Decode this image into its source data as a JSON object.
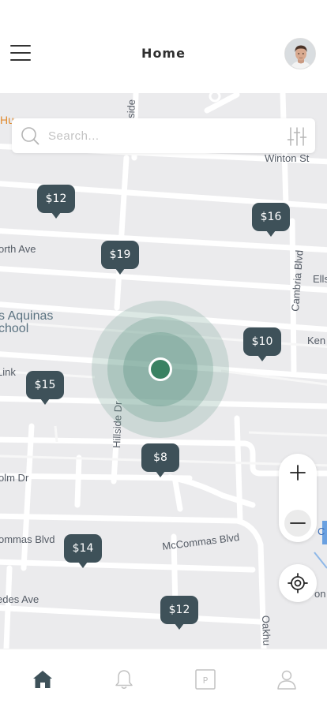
{
  "header": {
    "title": "Home",
    "menu_icon": "hamburger-menu-icon",
    "avatar": "user-avatar"
  },
  "search": {
    "placeholder": "Search...",
    "icon": "search-icon",
    "filter_icon": "filter-sliders-icon"
  },
  "map": {
    "street_labels": [
      "Winton St",
      "orth Ave",
      "Cambria Blvd",
      "Ells",
      "s Aquinas",
      "chool",
      "Ken",
      "Link",
      "Hillside Dr",
      "olm Dr",
      "ommas Blvd",
      "McCommas Blvd",
      "edes Ave",
      "Oakhu",
      "side",
      "Hu",
      "C",
      "on C"
    ],
    "price_pins": [
      "$12",
      "$16",
      "$19",
      "$10",
      "$15",
      "$8",
      "$14",
      "$12"
    ],
    "accent_color": "#3e5159",
    "location_color": "#3a8262"
  },
  "controls": {
    "zoom_in_icon": "plus-icon",
    "zoom_out_icon": "minus-icon",
    "locate_icon": "crosshair-locate-icon"
  },
  "tabbar": {
    "tabs": [
      {
        "name": "home",
        "icon": "home-icon",
        "active": true
      },
      {
        "name": "notifications",
        "icon": "bell-icon",
        "active": false
      },
      {
        "name": "parking",
        "icon": "parking-icon",
        "active": false
      },
      {
        "name": "profile",
        "icon": "person-icon",
        "active": false
      }
    ]
  }
}
